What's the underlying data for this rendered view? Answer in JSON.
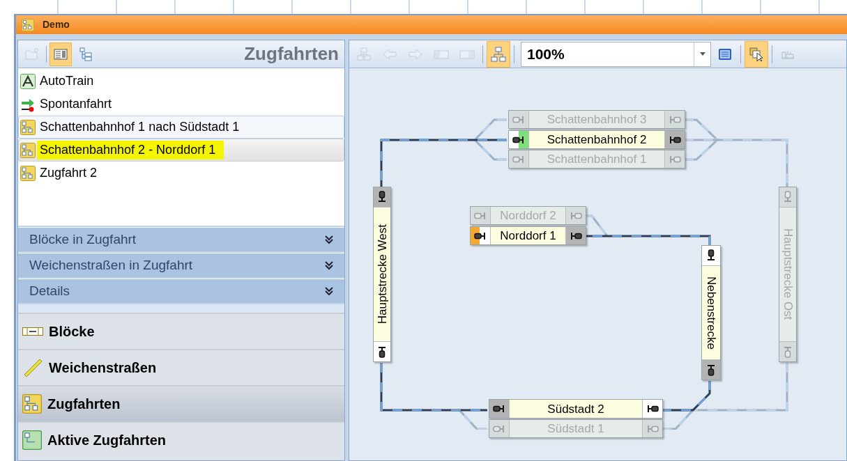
{
  "window": {
    "title": "Demo"
  },
  "left_panel": {
    "toolbar": [
      {
        "kind": "folder",
        "selected": false,
        "disabled": true
      },
      {
        "kind": "separator"
      },
      {
        "kind": "list",
        "selected": true,
        "disabled": false
      },
      {
        "kind": "tree",
        "selected": false,
        "disabled": false
      }
    ],
    "title": "Zugfahrten",
    "items": [
      {
        "label": "AutoTrain",
        "kind": "auto",
        "selected": false,
        "hovered": false,
        "marked": false
      },
      {
        "label": "Spontanfahrt",
        "kind": "spontan",
        "selected": false,
        "hovered": false,
        "marked": false
      },
      {
        "label": "Schattenbahnhof 1 nach Südstadt 1",
        "kind": "route",
        "selected": false,
        "hovered": true,
        "marked": false
      },
      {
        "label": "Schattenbahnhof 2 - Norddorf 1",
        "kind": "route",
        "selected": true,
        "hovered": false,
        "marked": true
      },
      {
        "label": "Zugfahrt 2",
        "kind": "route",
        "selected": false,
        "hovered": false,
        "marked": false
      }
    ],
    "sections": [
      {
        "label": "Blöcke in Zugfahrt",
        "expanded": false
      },
      {
        "label": "Weichenstraßen in Zugfahrt",
        "expanded": false
      },
      {
        "label": "Details",
        "expanded": false
      }
    ],
    "nav": [
      {
        "label": "Blöcke",
        "kind": "blocks",
        "selected": false
      },
      {
        "label": "Weichenstraßen",
        "kind": "switches",
        "selected": false
      },
      {
        "label": "Zugfahrten",
        "kind": "routes",
        "selected": true
      },
      {
        "label": "Aktive Zugfahrten",
        "kind": "active",
        "selected": false
      }
    ]
  },
  "diagram_toolbar": {
    "buttons": [
      {
        "kind": "export",
        "selected": false,
        "disabled": true
      },
      {
        "kind": "back",
        "selected": false,
        "disabled": true
      },
      {
        "kind": "forward",
        "selected": false,
        "disabled": true
      },
      {
        "kind": "pane-left",
        "selected": false,
        "disabled": true
      },
      {
        "kind": "pane-right",
        "selected": false,
        "disabled": true
      },
      {
        "kind": "separator"
      },
      {
        "kind": "layout",
        "selected": true,
        "disabled": false
      },
      {
        "kind": "separator"
      },
      {
        "kind": "zoom",
        "value": "100%"
      },
      {
        "kind": "screen",
        "selected": false,
        "disabled": false
      },
      {
        "kind": "separator"
      },
      {
        "kind": "select",
        "selected": true,
        "disabled": false
      },
      {
        "kind": "separator"
      },
      {
        "kind": "train",
        "selected": false,
        "disabled": true
      }
    ]
  },
  "blocks": [
    {
      "label": "Schattenbahnhof 3",
      "kind": "horizontal",
      "active": false,
      "ends": [
        {
          "kind": "off"
        },
        {
          "kind": "off"
        }
      ]
    },
    {
      "label": "Schattenbahnhof 2",
      "kind": "horizontal",
      "active": true,
      "ends": [
        {
          "kind": "green"
        },
        {
          "kind": "dark"
        }
      ]
    },
    {
      "label": "Schattenbahnhof 1",
      "kind": "horizontal",
      "active": false,
      "ends": [
        {
          "kind": "off"
        },
        {
          "kind": "off"
        }
      ]
    },
    {
      "label": "Norddorf 2",
      "kind": "horizontal",
      "active": false,
      "ends": [
        {
          "kind": "off"
        },
        {
          "kind": "off"
        }
      ]
    },
    {
      "label": "Norddorf 1",
      "kind": "horizontal",
      "active": true,
      "ends": [
        {
          "kind": "orange"
        },
        {
          "kind": "dark"
        }
      ]
    },
    {
      "label": "Hauptstrecke West",
      "kind": "up",
      "active": true,
      "ends": [
        {
          "kind": "dark"
        },
        {
          "kind": "light"
        }
      ]
    },
    {
      "label": "Nebenstrecke",
      "kind": "down",
      "active": true,
      "ends": [
        {
          "kind": "light"
        },
        {
          "kind": "dark"
        }
      ]
    },
    {
      "label": "Hauptstrecke Ost",
      "kind": "down",
      "active": false,
      "ends": [
        {
          "kind": "off"
        },
        {
          "kind": "off"
        }
      ]
    },
    {
      "label": "Südstadt 2",
      "kind": "horizontal",
      "active": true,
      "ends": [
        {
          "kind": "dark"
        },
        {
          "kind": "light"
        }
      ]
    },
    {
      "label": "Südstadt 1",
      "kind": "horizontal",
      "active": false,
      "ends": [
        {
          "kind": "off"
        },
        {
          "kind": "off"
        }
      ]
    }
  ]
}
